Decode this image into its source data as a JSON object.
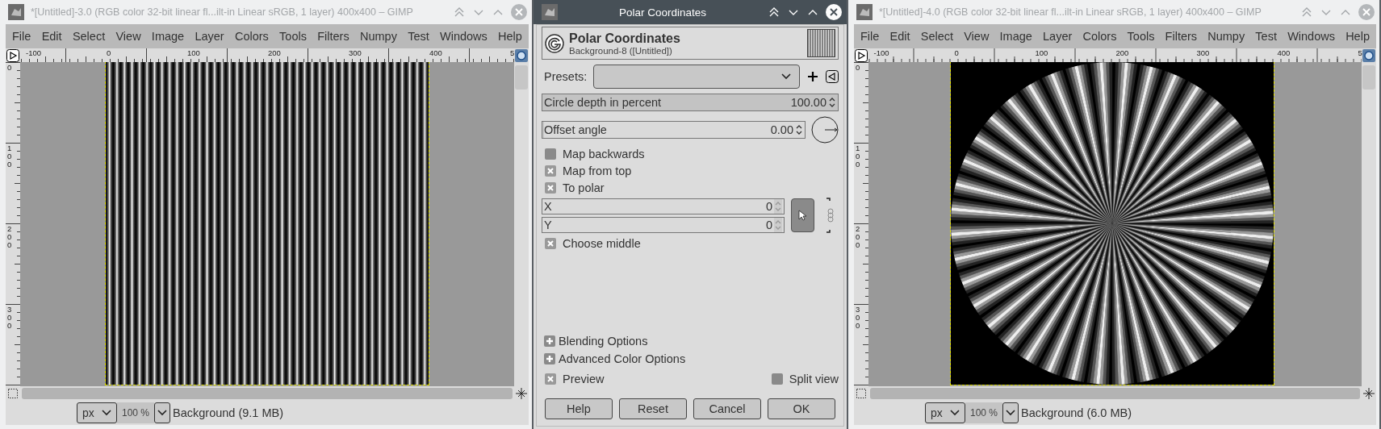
{
  "windows": [
    {
      "kind": "image",
      "active": false,
      "title": "*[Untitled]-3.0 (RGB color 32-bit linear fl...ilt-in Linear sRGB, 1 layer) 400x400 – GIMP",
      "menu": [
        "File",
        "Edit",
        "Select",
        "View",
        "Image",
        "Layer",
        "Colors",
        "Tools",
        "Filters",
        "Numpy",
        "Test",
        "Windows",
        "Help"
      ],
      "rulers": {
        "horizontal": [
          "-100",
          "0",
          "100",
          "200",
          "300",
          "400",
          "5"
        ],
        "vertical": [
          "0",
          "100",
          "200",
          "300"
        ]
      },
      "image": {
        "kind": "stripes"
      },
      "status": {
        "unit": "px",
        "zoom": "100 %",
        "layer": "Background (9.1 MB)"
      }
    },
    {
      "kind": "dialog",
      "active": true,
      "title": "Polar Coordinates",
      "header": {
        "title": "Polar Coordinates",
        "subtitle": "Background-8 ([Untitled])"
      },
      "presets": {
        "label": "Presets:"
      },
      "fields": [
        {
          "kind": "scale",
          "label": "Circle depth in percent",
          "value": "100.00",
          "level": 1
        },
        {
          "kind": "angle",
          "label": "Offset angle",
          "value": "0.00",
          "level": 0
        }
      ],
      "controls": [
        {
          "kind": "checkbox",
          "label": "Map backwards",
          "checked": false
        },
        {
          "kind": "checkbox",
          "label": "Map from top",
          "checked": true
        },
        {
          "kind": "checkbox",
          "label": "To polar",
          "checked": true
        },
        {
          "kind": "coordinates",
          "fields": [
            {
              "label": "X",
              "value": "0"
            },
            {
              "label": "Y",
              "value": "0"
            }
          ]
        },
        {
          "kind": "checkbox",
          "label": "Choose middle",
          "checked": true
        }
      ],
      "expanders": [
        {
          "label": "Blending Options",
          "expanded": false
        },
        {
          "label": "Advanced Color Options",
          "expanded": false
        }
      ],
      "preview": {
        "label": "Preview",
        "checked": true
      },
      "split_view": {
        "label": "Split view",
        "checked": false
      },
      "buttons": [
        "Help",
        "Reset",
        "Cancel",
        "OK"
      ]
    },
    {
      "kind": "image",
      "active": false,
      "title": "*[Untitled]-4.0 (RGB color 32-bit linear fl...ilt-in Linear sRGB, 1 layer) 400x400 – GIMP",
      "menu": [
        "File",
        "Edit",
        "Select",
        "View",
        "Image",
        "Layer",
        "Colors",
        "Tools",
        "Filters",
        "Numpy",
        "Test",
        "Windows",
        "Help"
      ],
      "rulers": {
        "horizontal": [
          "-100",
          "0",
          "100",
          "200",
          "300",
          "400",
          "5"
        ],
        "vertical": [
          "0",
          "100",
          "200",
          "300"
        ]
      },
      "image": {
        "kind": "starburst"
      },
      "status": {
        "unit": "px",
        "zoom": "100 %",
        "layer": "Background (6.0 MB)"
      }
    }
  ]
}
